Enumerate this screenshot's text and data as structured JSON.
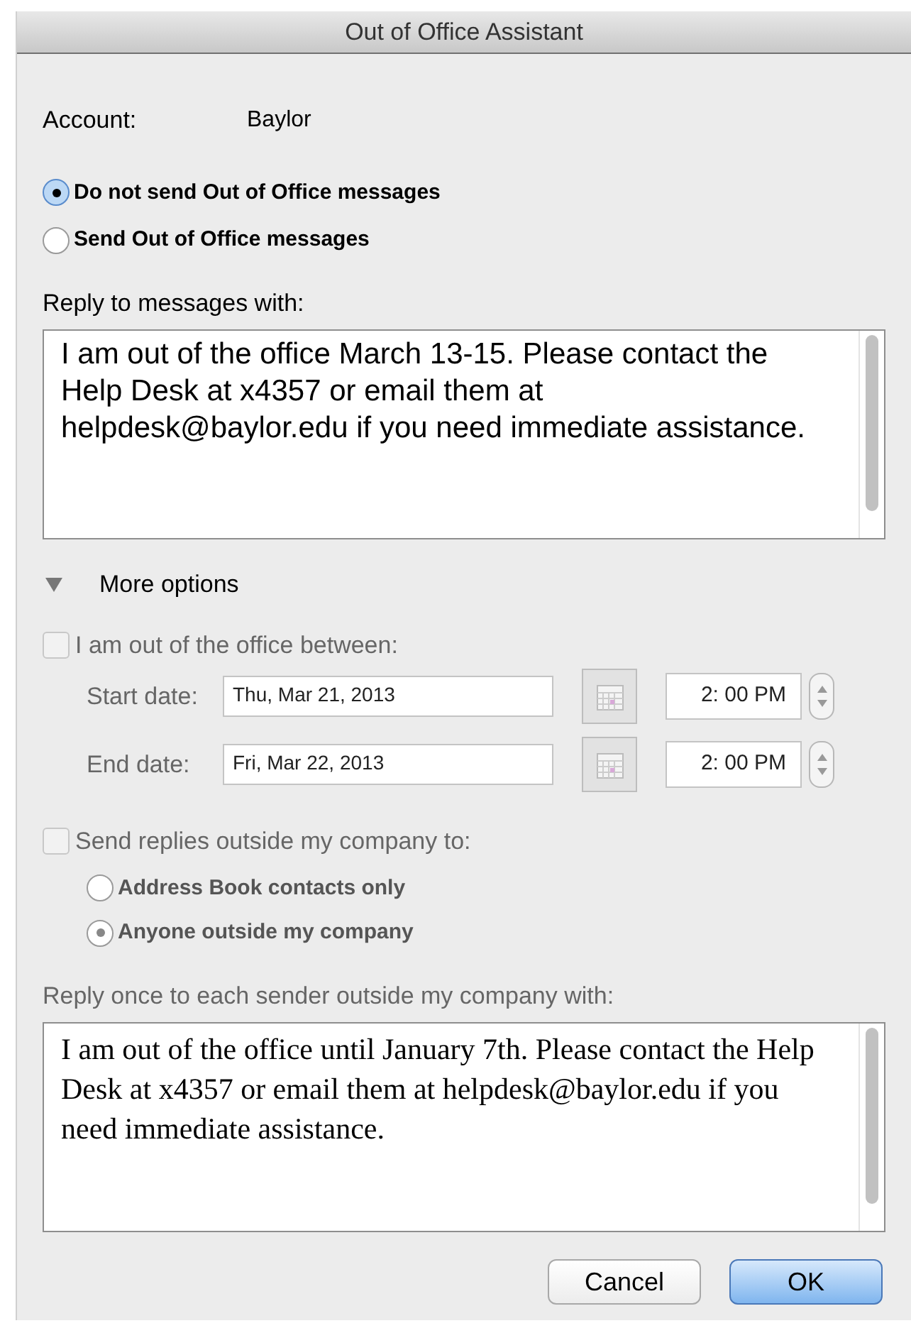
{
  "window": {
    "title": "Out of Office Assistant"
  },
  "account": {
    "label": "Account:",
    "value": "Baylor"
  },
  "send_mode": [
    {
      "label": "Do not send Out of Office messages",
      "selected": true
    },
    {
      "label": "Send Out of Office messages",
      "selected": false
    }
  ],
  "reply": {
    "label": "Reply to messages with:",
    "value": "I am out of the office March 13-15. Please contact the Help Desk at x4357 or email them at helpdesk@baylor.edu if you need immediate assistance."
  },
  "more_options": {
    "label": "More options",
    "expanded": true
  },
  "date_range": {
    "label": "I am out of the office between:",
    "checked": false,
    "disabled": true,
    "rows": [
      {
        "label": "Start date:",
        "date": "Thu, Mar 21, 2013",
        "time": "2: 00 PM"
      },
      {
        "label": "End date:",
        "date": "Fri, Mar 22, 2013",
        "time": "2: 00 PM"
      }
    ]
  },
  "outside": {
    "label": "Send replies outside my company to:",
    "checked": false,
    "disabled": true,
    "options": [
      {
        "label": "Address Book contacts only",
        "selected": false
      },
      {
        "label": "Anyone outside my company",
        "selected": true
      }
    ]
  },
  "outside_reply": {
    "label": "Reply once to each sender outside my company with:",
    "disabled": true,
    "value": "I am out of the office until January 7th. Please contact the Help Desk at x4357 or email them at helpdesk@baylor.edu if you need immediate assistance."
  },
  "buttons": [
    {
      "label": "Cancel",
      "kind": "normal"
    },
    {
      "label": "OK",
      "kind": "default"
    }
  ]
}
